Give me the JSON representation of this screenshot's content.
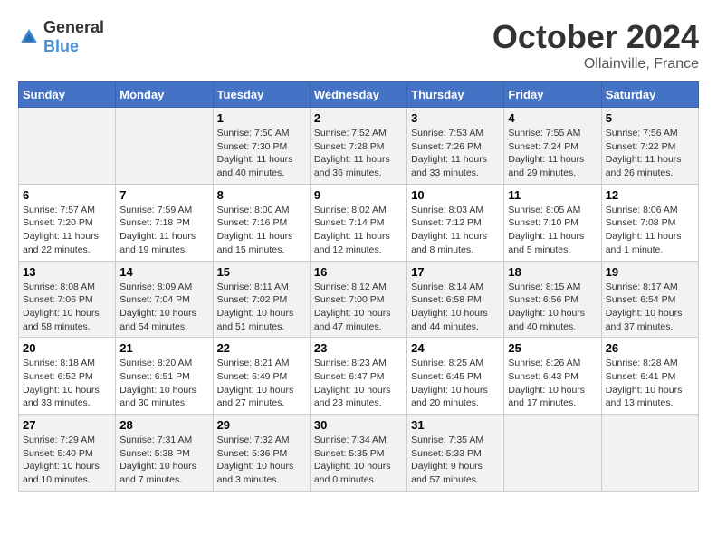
{
  "header": {
    "logo_general": "General",
    "logo_blue": "Blue",
    "month": "October 2024",
    "location": "Ollainville, France"
  },
  "weekdays": [
    "Sunday",
    "Monday",
    "Tuesday",
    "Wednesday",
    "Thursday",
    "Friday",
    "Saturday"
  ],
  "weeks": [
    [
      {
        "day": "",
        "sunrise": "",
        "sunset": "",
        "daylight": ""
      },
      {
        "day": "",
        "sunrise": "",
        "sunset": "",
        "daylight": ""
      },
      {
        "day": "1",
        "sunrise": "Sunrise: 7:50 AM",
        "sunset": "Sunset: 7:30 PM",
        "daylight": "Daylight: 11 hours and 40 minutes."
      },
      {
        "day": "2",
        "sunrise": "Sunrise: 7:52 AM",
        "sunset": "Sunset: 7:28 PM",
        "daylight": "Daylight: 11 hours and 36 minutes."
      },
      {
        "day": "3",
        "sunrise": "Sunrise: 7:53 AM",
        "sunset": "Sunset: 7:26 PM",
        "daylight": "Daylight: 11 hours and 33 minutes."
      },
      {
        "day": "4",
        "sunrise": "Sunrise: 7:55 AM",
        "sunset": "Sunset: 7:24 PM",
        "daylight": "Daylight: 11 hours and 29 minutes."
      },
      {
        "day": "5",
        "sunrise": "Sunrise: 7:56 AM",
        "sunset": "Sunset: 7:22 PM",
        "daylight": "Daylight: 11 hours and 26 minutes."
      }
    ],
    [
      {
        "day": "6",
        "sunrise": "Sunrise: 7:57 AM",
        "sunset": "Sunset: 7:20 PM",
        "daylight": "Daylight: 11 hours and 22 minutes."
      },
      {
        "day": "7",
        "sunrise": "Sunrise: 7:59 AM",
        "sunset": "Sunset: 7:18 PM",
        "daylight": "Daylight: 11 hours and 19 minutes."
      },
      {
        "day": "8",
        "sunrise": "Sunrise: 8:00 AM",
        "sunset": "Sunset: 7:16 PM",
        "daylight": "Daylight: 11 hours and 15 minutes."
      },
      {
        "day": "9",
        "sunrise": "Sunrise: 8:02 AM",
        "sunset": "Sunset: 7:14 PM",
        "daylight": "Daylight: 11 hours and 12 minutes."
      },
      {
        "day": "10",
        "sunrise": "Sunrise: 8:03 AM",
        "sunset": "Sunset: 7:12 PM",
        "daylight": "Daylight: 11 hours and 8 minutes."
      },
      {
        "day": "11",
        "sunrise": "Sunrise: 8:05 AM",
        "sunset": "Sunset: 7:10 PM",
        "daylight": "Daylight: 11 hours and 5 minutes."
      },
      {
        "day": "12",
        "sunrise": "Sunrise: 8:06 AM",
        "sunset": "Sunset: 7:08 PM",
        "daylight": "Daylight: 11 hours and 1 minute."
      }
    ],
    [
      {
        "day": "13",
        "sunrise": "Sunrise: 8:08 AM",
        "sunset": "Sunset: 7:06 PM",
        "daylight": "Daylight: 10 hours and 58 minutes."
      },
      {
        "day": "14",
        "sunrise": "Sunrise: 8:09 AM",
        "sunset": "Sunset: 7:04 PM",
        "daylight": "Daylight: 10 hours and 54 minutes."
      },
      {
        "day": "15",
        "sunrise": "Sunrise: 8:11 AM",
        "sunset": "Sunset: 7:02 PM",
        "daylight": "Daylight: 10 hours and 51 minutes."
      },
      {
        "day": "16",
        "sunrise": "Sunrise: 8:12 AM",
        "sunset": "Sunset: 7:00 PM",
        "daylight": "Daylight: 10 hours and 47 minutes."
      },
      {
        "day": "17",
        "sunrise": "Sunrise: 8:14 AM",
        "sunset": "Sunset: 6:58 PM",
        "daylight": "Daylight: 10 hours and 44 minutes."
      },
      {
        "day": "18",
        "sunrise": "Sunrise: 8:15 AM",
        "sunset": "Sunset: 6:56 PM",
        "daylight": "Daylight: 10 hours and 40 minutes."
      },
      {
        "day": "19",
        "sunrise": "Sunrise: 8:17 AM",
        "sunset": "Sunset: 6:54 PM",
        "daylight": "Daylight: 10 hours and 37 minutes."
      }
    ],
    [
      {
        "day": "20",
        "sunrise": "Sunrise: 8:18 AM",
        "sunset": "Sunset: 6:52 PM",
        "daylight": "Daylight: 10 hours and 33 minutes."
      },
      {
        "day": "21",
        "sunrise": "Sunrise: 8:20 AM",
        "sunset": "Sunset: 6:51 PM",
        "daylight": "Daylight: 10 hours and 30 minutes."
      },
      {
        "day": "22",
        "sunrise": "Sunrise: 8:21 AM",
        "sunset": "Sunset: 6:49 PM",
        "daylight": "Daylight: 10 hours and 27 minutes."
      },
      {
        "day": "23",
        "sunrise": "Sunrise: 8:23 AM",
        "sunset": "Sunset: 6:47 PM",
        "daylight": "Daylight: 10 hours and 23 minutes."
      },
      {
        "day": "24",
        "sunrise": "Sunrise: 8:25 AM",
        "sunset": "Sunset: 6:45 PM",
        "daylight": "Daylight: 10 hours and 20 minutes."
      },
      {
        "day": "25",
        "sunrise": "Sunrise: 8:26 AM",
        "sunset": "Sunset: 6:43 PM",
        "daylight": "Daylight: 10 hours and 17 minutes."
      },
      {
        "day": "26",
        "sunrise": "Sunrise: 8:28 AM",
        "sunset": "Sunset: 6:41 PM",
        "daylight": "Daylight: 10 hours and 13 minutes."
      }
    ],
    [
      {
        "day": "27",
        "sunrise": "Sunrise: 7:29 AM",
        "sunset": "Sunset: 5:40 PM",
        "daylight": "Daylight: 10 hours and 10 minutes."
      },
      {
        "day": "28",
        "sunrise": "Sunrise: 7:31 AM",
        "sunset": "Sunset: 5:38 PM",
        "daylight": "Daylight: 10 hours and 7 minutes."
      },
      {
        "day": "29",
        "sunrise": "Sunrise: 7:32 AM",
        "sunset": "Sunset: 5:36 PM",
        "daylight": "Daylight: 10 hours and 3 minutes."
      },
      {
        "day": "30",
        "sunrise": "Sunrise: 7:34 AM",
        "sunset": "Sunset: 5:35 PM",
        "daylight": "Daylight: 10 hours and 0 minutes."
      },
      {
        "day": "31",
        "sunrise": "Sunrise: 7:35 AM",
        "sunset": "Sunset: 5:33 PM",
        "daylight": "Daylight: 9 hours and 57 minutes."
      },
      {
        "day": "",
        "sunrise": "",
        "sunset": "",
        "daylight": ""
      },
      {
        "day": "",
        "sunrise": "",
        "sunset": "",
        "daylight": ""
      }
    ]
  ]
}
